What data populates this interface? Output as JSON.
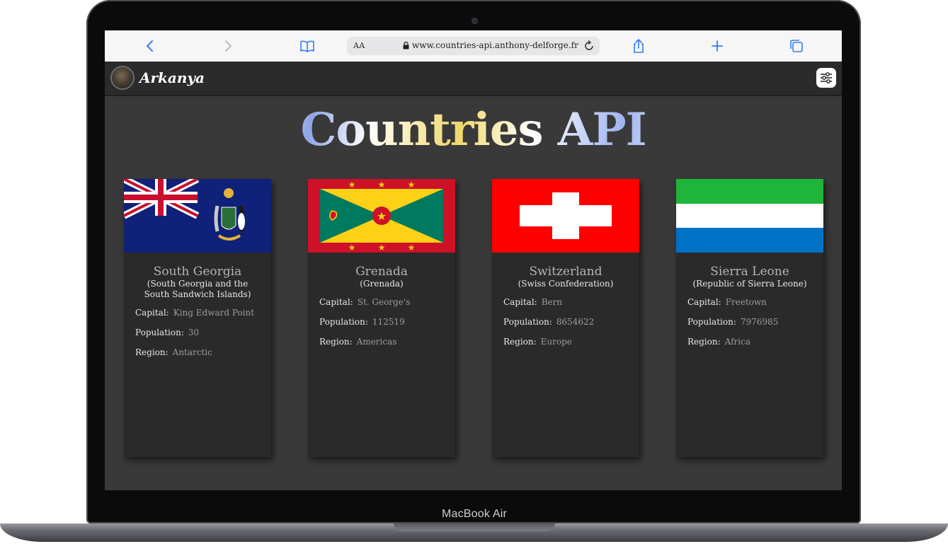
{
  "device": {
    "label": "MacBook Air"
  },
  "browser": {
    "text_size_label": "AA",
    "url": "www.countries-api.anthony-delforge.fr"
  },
  "app": {
    "brand": "Arkanya",
    "title": "Countries API"
  },
  "labels": {
    "capital": "Capital:",
    "population": "Population:",
    "region": "Region:"
  },
  "countries": [
    {
      "name": "South Georgia",
      "official": "(South Georgia and the South Sandwich Islands)",
      "capital": "King Edward Point",
      "population": "30",
      "region": "Antarctic"
    },
    {
      "name": "Grenada",
      "official": "(Grenada)",
      "capital": "St. George's",
      "population": "112519",
      "region": "Americas"
    },
    {
      "name": "Switzerland",
      "official": "(Swiss Confederation)",
      "capital": "Bern",
      "population": "8654622",
      "region": "Europe"
    },
    {
      "name": "Sierra Leone",
      "official": "(Republic of Sierra Leone)",
      "capital": "Freetown",
      "population": "7976985",
      "region": "Africa"
    }
  ],
  "icons": {
    "back": "chevron-left-icon",
    "forward": "chevron-right-icon",
    "bookmarks": "book-icon",
    "lock": "lock-icon",
    "reload": "reload-icon",
    "share": "share-icon",
    "new_tab": "plus-icon",
    "tabs": "tabs-icon",
    "settings": "sliders-icon"
  },
  "colors": {
    "page_background": "#3a3939",
    "card_background": "#2b2a2a",
    "link_blue": "#2f7bf5"
  }
}
